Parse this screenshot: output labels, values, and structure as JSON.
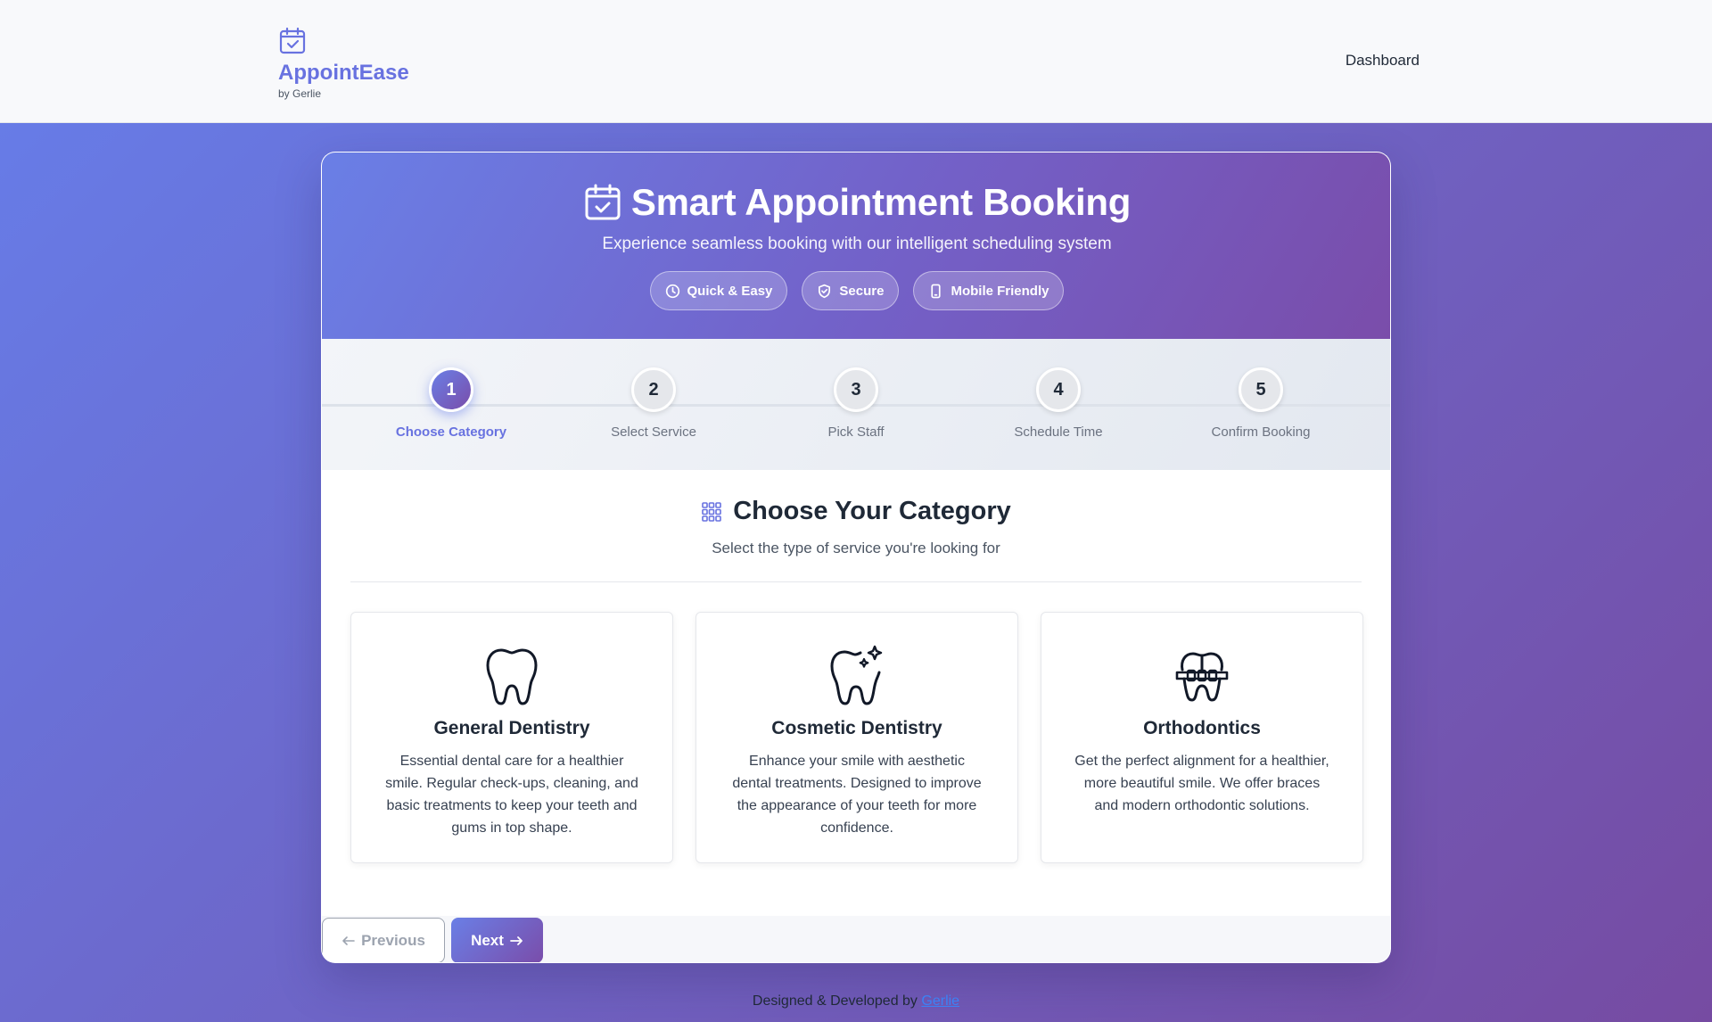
{
  "nav": {
    "brand_name": "AppointEase",
    "brand_sub": "by Gerlie",
    "brand_icon": "calendar-check-icon",
    "link_dashboard": "Dashboard"
  },
  "hero": {
    "title": "Smart Appointment Booking",
    "subtitle": "Experience seamless booking with our intelligent scheduling system",
    "pills": [
      {
        "label": "Quick & Easy",
        "icon": "clock-icon"
      },
      {
        "label": "Secure",
        "icon": "shield-icon"
      },
      {
        "label": "Mobile Friendly",
        "icon": "mobile-icon"
      }
    ]
  },
  "steps": [
    {
      "number": "1",
      "label": "Choose Category",
      "active": true
    },
    {
      "number": "2",
      "label": "Select Service",
      "active": false
    },
    {
      "number": "3",
      "label": "Pick Staff",
      "active": false
    },
    {
      "number": "4",
      "label": "Schedule Time",
      "active": false
    },
    {
      "number": "5",
      "label": "Confirm Booking",
      "active": false
    }
  ],
  "section": {
    "title": "Choose Your Category",
    "subtitle": "Select the type of service you're looking for",
    "icon": "grid-icon"
  },
  "categories": [
    {
      "title": "General Dentistry",
      "description": "Essential dental care for a healthier smile. Regular check-ups, cleaning, and basic treatments to keep your teeth and gums in top shape.",
      "icon": "tooth-icon"
    },
    {
      "title": "Cosmetic Dentistry",
      "description": "Enhance your smile with aesthetic dental treatments. Designed to improve the appearance of your teeth for more confidence.",
      "icon": "sparkle-tooth-icon"
    },
    {
      "title": "Orthodontics",
      "description": "Get the perfect alignment for a healthier, more beautiful smile. We offer braces and modern orthodontic solutions.",
      "icon": "braces-icon"
    }
  ],
  "buttons": {
    "previous": "Previous",
    "next": "Next"
  },
  "footer": {
    "credit_text": "Designed & Developed by",
    "credit_link": "Gerlie"
  },
  "colors": {
    "accent": "#6872e0",
    "gradient_start": "#667eea",
    "gradient_end": "#764ba2"
  }
}
